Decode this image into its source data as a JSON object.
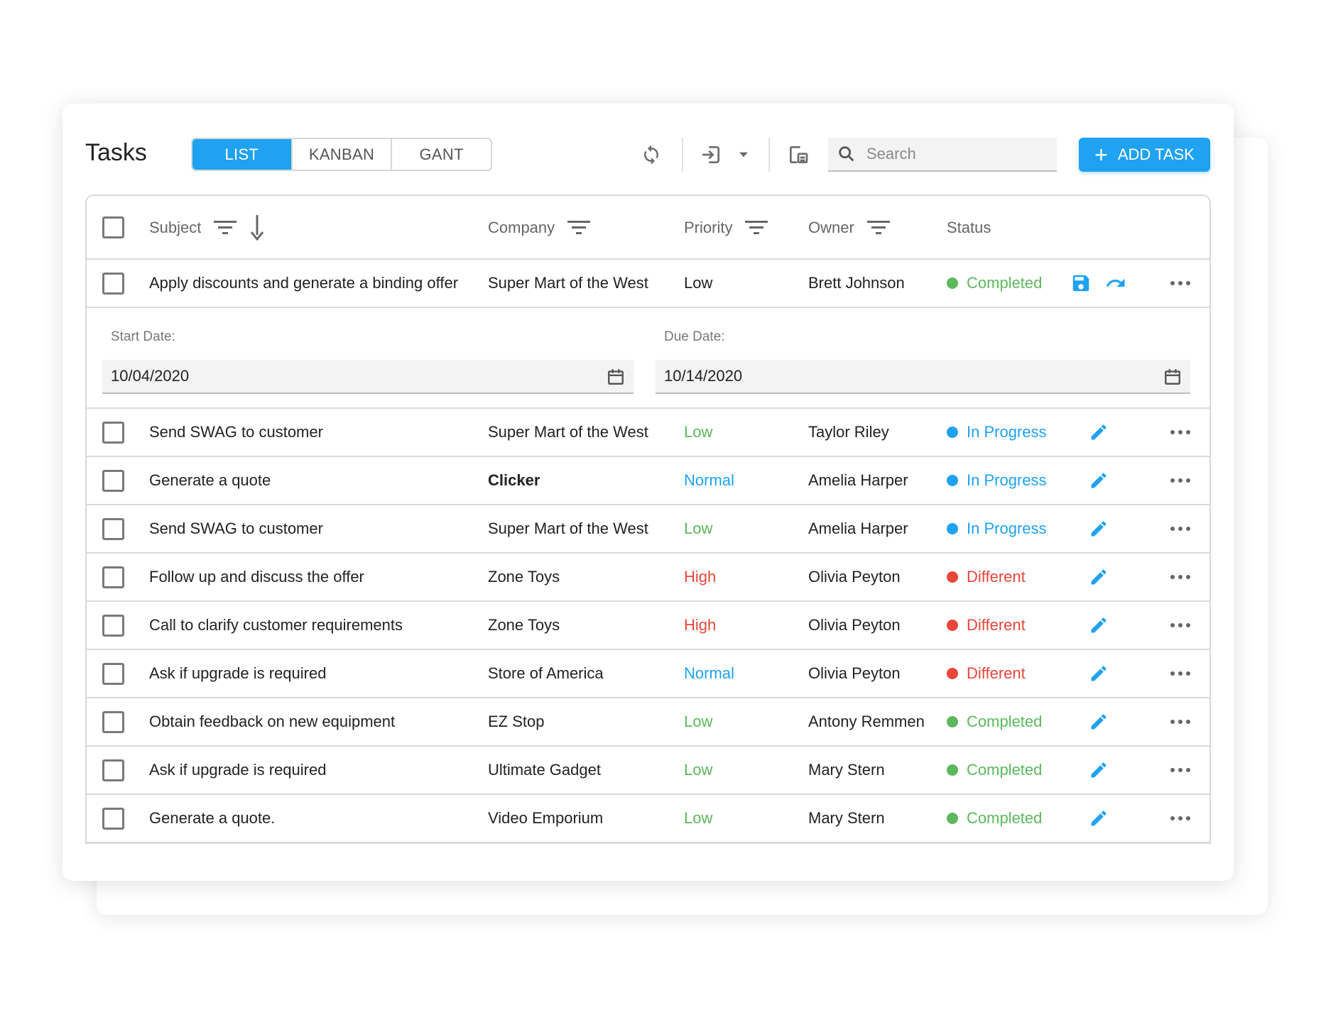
{
  "title": "Tasks",
  "views": [
    "LIST",
    "KANBAN",
    "GANT"
  ],
  "active_view": "LIST",
  "search": {
    "placeholder": "Search"
  },
  "add_task_label": "ADD TASK",
  "columns": {
    "subject": "Subject",
    "company": "Company",
    "priority": "Priority",
    "owner": "Owner",
    "status": "Status"
  },
  "colors": {
    "accent": "#1fa2f1",
    "low": "#5cb85c",
    "normal": "#1fa2f1",
    "high": "#e8463a",
    "completed": "#5cb85c",
    "in_progress": "#1fa2f1",
    "different": "#e8463a"
  },
  "editing_row": {
    "subject": "Apply discounts and generate a binding offer",
    "company": "Super Mart of the West",
    "priority": "Low",
    "owner": "Brett Johnson",
    "status": "Completed",
    "start_label": "Start Date:",
    "start_value": "10/04/2020",
    "due_label": "Due Date:",
    "due_value": "10/14/2020"
  },
  "rows": [
    {
      "subject": "Send SWAG to customer",
      "company": "Super Mart of the West",
      "priority": "Low",
      "owner": "Taylor Riley",
      "status": "In Progress"
    },
    {
      "subject": "Generate a quote",
      "company": "Clicker",
      "priority": "Normal",
      "owner": "Amelia Harper",
      "status": "In Progress"
    },
    {
      "subject": "Send SWAG to customer",
      "company": "Super Mart of the West",
      "priority": "Low",
      "owner": "Amelia Harper",
      "status": "In Progress"
    },
    {
      "subject": "Follow up and discuss the offer",
      "company": "Zone Toys",
      "priority": "High",
      "owner": "Olivia Peyton",
      "status": "Different"
    },
    {
      "subject": "Call to clarify customer requirements",
      "company": "Zone Toys",
      "priority": "High",
      "owner": "Olivia Peyton",
      "status": "Different"
    },
    {
      "subject": "Ask if upgrade is required",
      "company": "Store of America",
      "priority": "Normal",
      "owner": "Olivia Peyton",
      "status": "Different"
    },
    {
      "subject": "Obtain feedback on new equipment",
      "company": "EZ Stop",
      "priority": "Low",
      "owner": "Antony Remmen",
      "status": "Completed"
    },
    {
      "subject": "Ask if upgrade is required",
      "company": "Ultimate Gadget",
      "priority": "Low",
      "owner": "Mary Stern",
      "status": "Completed"
    },
    {
      "subject": "Generate a quote.",
      "company": "Video Emporium",
      "priority": "Low",
      "owner": "Mary Stern",
      "status": "Completed"
    }
  ]
}
